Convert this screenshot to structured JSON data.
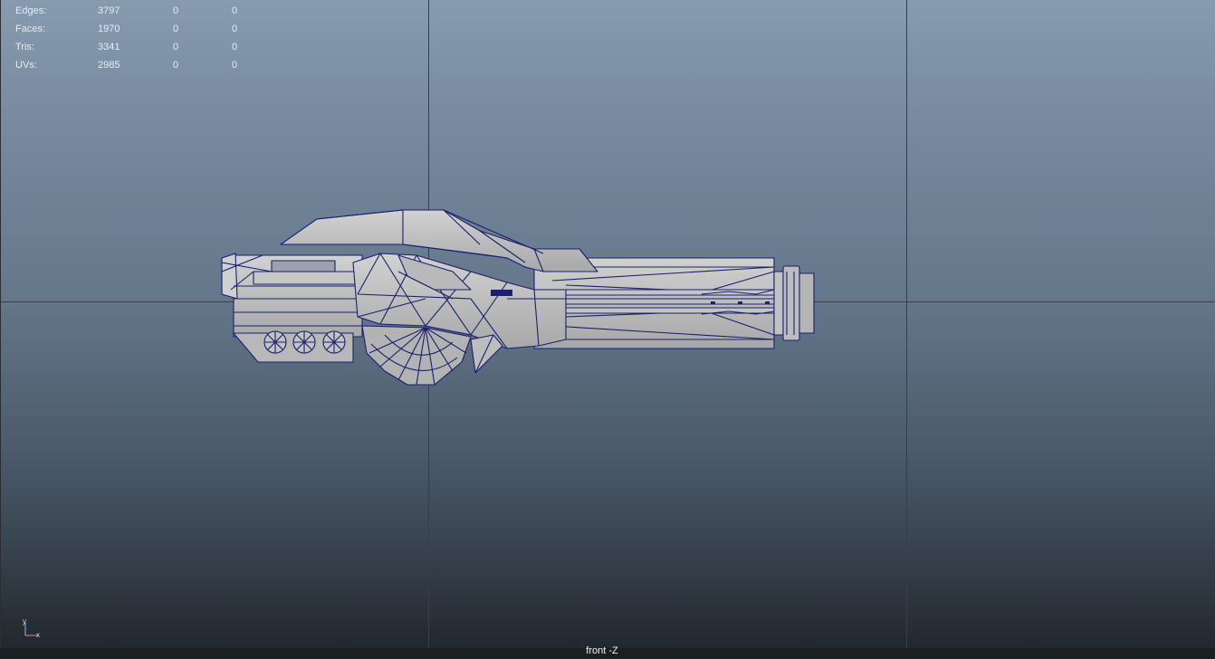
{
  "viewport": {
    "camera_label": "front -Z",
    "colors": {
      "background_top": "#869bb0",
      "background_bottom": "#1f242a",
      "wireframe": "#1a1f6e",
      "mesh_fill": "#c9c9c9",
      "grid_line": "#3a3e44"
    }
  },
  "hud": {
    "rows": [
      {
        "label": "Edges:",
        "v1": "3797",
        "v2": "0",
        "v3": "0"
      },
      {
        "label": "Faces:",
        "v1": "1970",
        "v2": "0",
        "v3": "0"
      },
      {
        "label": "Tris:",
        "v1": "3341",
        "v2": "0",
        "v3": "0"
      },
      {
        "label": "UVs:",
        "v1": "2985",
        "v2": "0",
        "v3": "0"
      }
    ]
  },
  "axis_gizmo": {
    "y_label": "y",
    "x_label": "x",
    "icon": "axis-gizmo-icon"
  }
}
